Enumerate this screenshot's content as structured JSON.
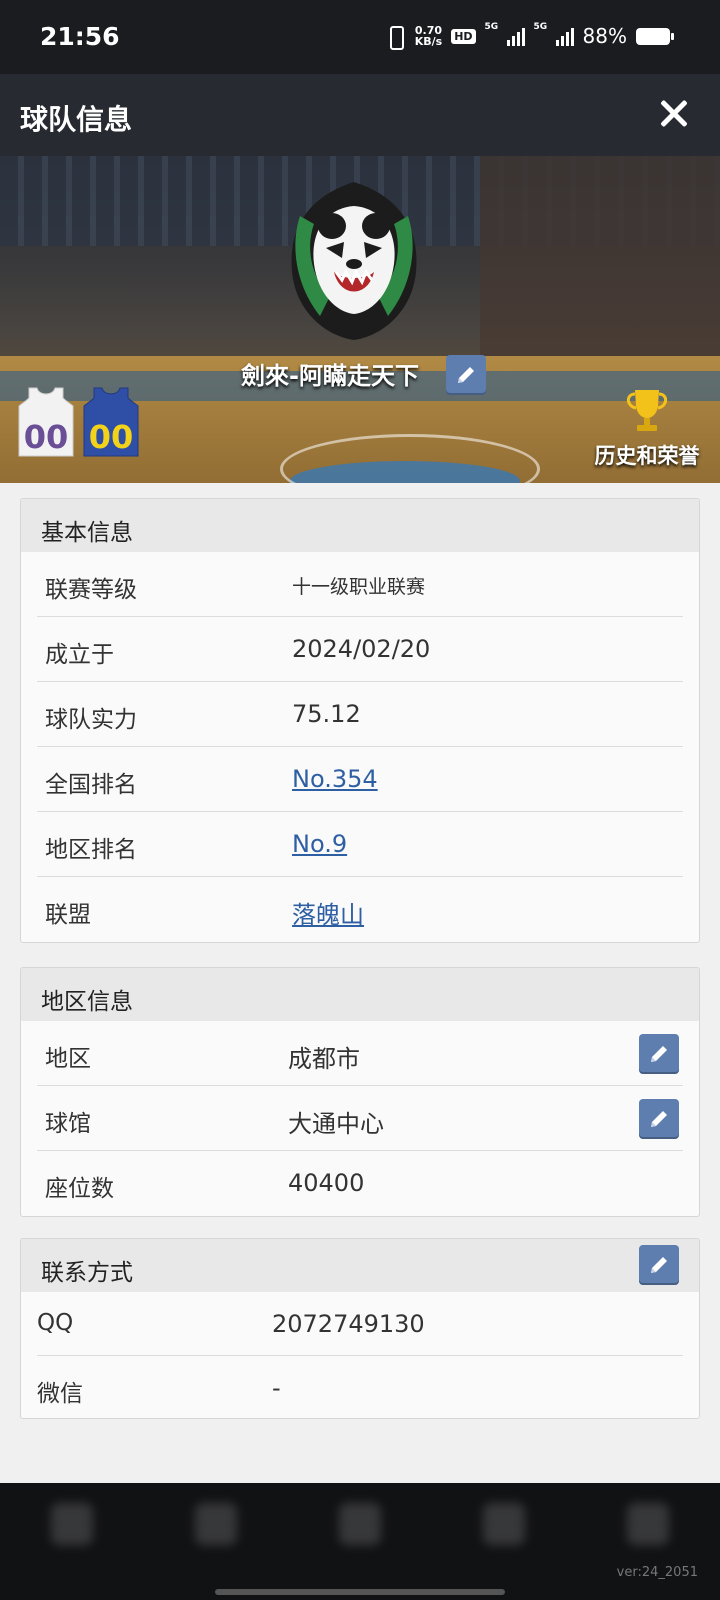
{
  "status_bar": {
    "time": "21:56",
    "net_speed_value": "0.70",
    "net_speed_unit": "KB/s",
    "hd_label": "HD",
    "sim1_label": "5G",
    "sim2_label": "5G",
    "battery": "88%"
  },
  "header": {
    "title": "球队信息",
    "close_icon": "close-icon"
  },
  "banner": {
    "team_name": "劍來-阿瞞走天下",
    "home_jersey_number": "00",
    "away_jersey_number": "00",
    "honors_label": "历史和荣誉",
    "colors": {
      "home_jersey": "#f2f2f2",
      "home_number": "#6a4e96",
      "away_jersey": "#2f4fa6",
      "away_number": "#f3d21a",
      "logo_green": "#2f8a45"
    }
  },
  "basic_info": {
    "title": "基本信息",
    "rows": [
      {
        "label": "联赛等级",
        "value": "十一级职业联赛"
      },
      {
        "label": "成立于",
        "value": "2024/02/20"
      },
      {
        "label": "球队实力",
        "value": "75.12"
      },
      {
        "label": "全国排名",
        "value": "No.354"
      },
      {
        "label": "地区排名",
        "value": "No.9"
      },
      {
        "label": "联盟",
        "value": "落魄山"
      }
    ]
  },
  "region_info": {
    "title": "地区信息",
    "rows": [
      {
        "label": "地区",
        "value": "成都市"
      },
      {
        "label": "球馆",
        "value": "大通中心"
      },
      {
        "label": "座位数",
        "value": "40400"
      }
    ]
  },
  "contact": {
    "title": "联系方式",
    "rows": [
      {
        "label": "QQ",
        "value": "2072749130"
      },
      {
        "label": "微信",
        "value": "-"
      }
    ]
  },
  "footer": {
    "version": "ver:24_2051"
  },
  "colors": {
    "accent_edit": "#5d7eae",
    "link": "#2f5fa3",
    "title_bar": "#272b31"
  }
}
